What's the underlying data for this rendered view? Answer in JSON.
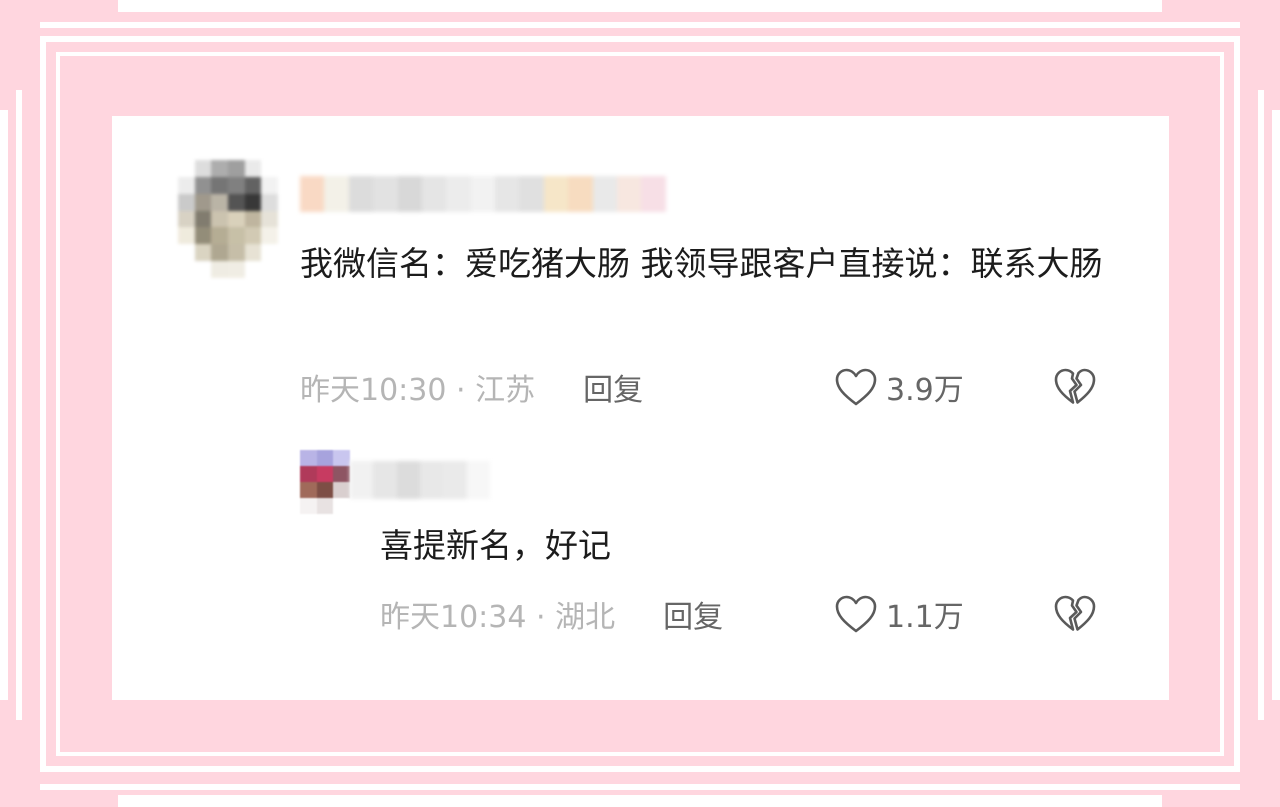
{
  "comment": {
    "text": "我微信名：爱吃猪大肠  我领导跟客户直接说：联系大肠",
    "time_location": "昨天10:30 · 江苏",
    "reply_label": "回复",
    "like_count": "3.9万",
    "icons": {
      "like": "heart-outline-icon",
      "dislike": "broken-heart-icon"
    }
  },
  "reply": {
    "text": "喜提新名，好记",
    "time_location": "昨天10:34 · 湖北",
    "reply_label": "回复",
    "like_count": "1.1万",
    "icons": {
      "like": "heart-outline-icon",
      "dislike": "broken-heart-icon"
    }
  },
  "colors": {
    "background_pink": "#ffd6df",
    "card": "#ffffff",
    "text": "#1c1c1c",
    "meta_gray": "#b5b5b5",
    "action_gray": "#666666"
  }
}
